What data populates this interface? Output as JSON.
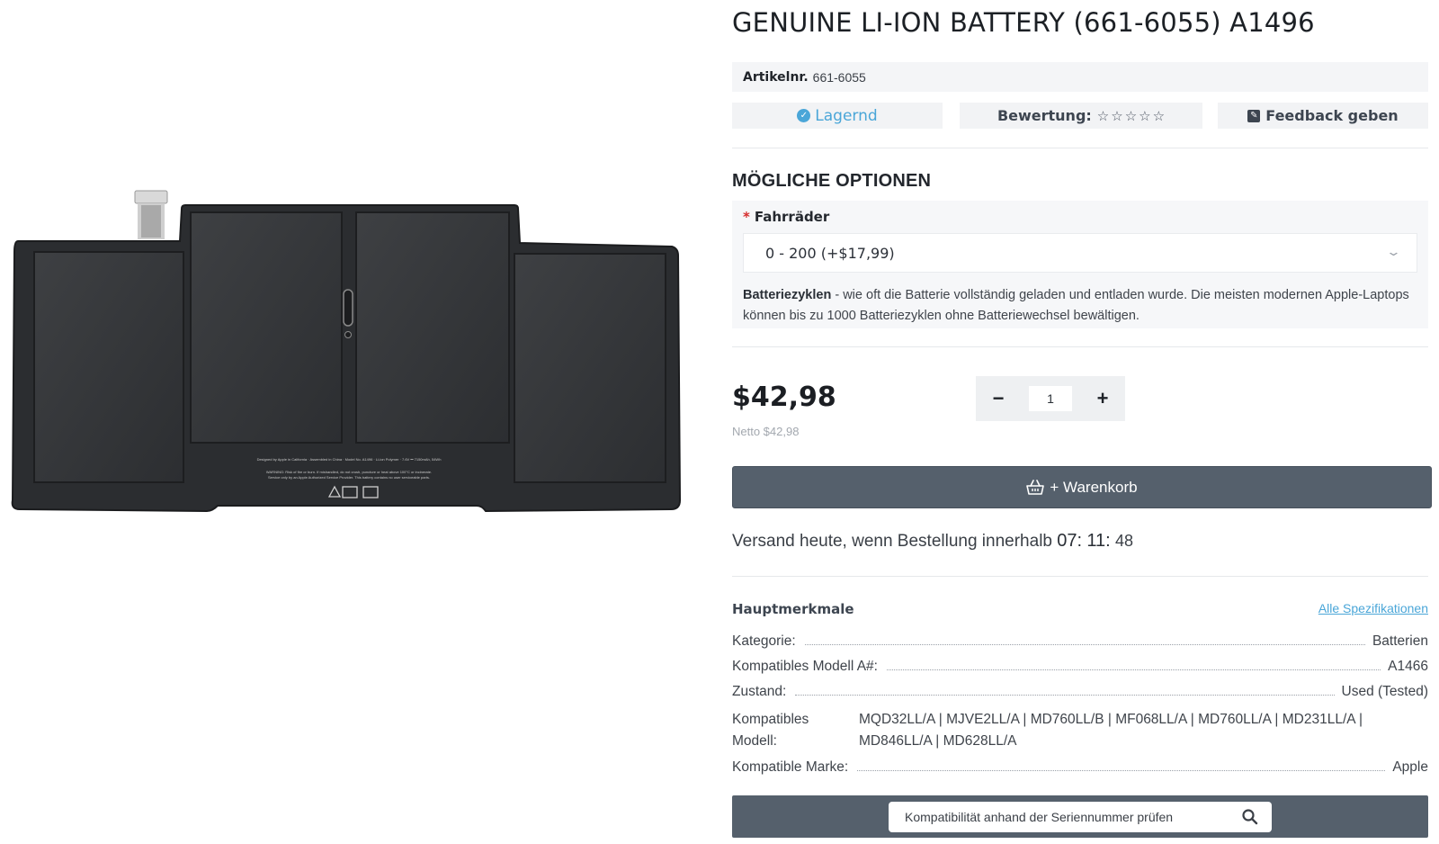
{
  "product": {
    "title": "GENUINE LI-ION BATTERY (661-6055) A1496",
    "sku_label": "Artikelnr.",
    "sku_value": "661-6055",
    "stock_label": "Lagernd",
    "rating_label": "Bewertung:",
    "rating_stars": 0,
    "feedback_label": "Feedback geben",
    "image_text": {
      "line1": "Designed by Apple in California · Assembled in China · Model No. A1496 · Li-ion Polymer · 7.6V ⎓ 7150mAh, 54Wh",
      "line2": "WARNING: Risk of fire or burn. If mishandled, do not crush, puncture or heat above 100°C or incinerate.",
      "line3": "Service only by an Apple Authorized Service Provider. This battery contains no user serviceable parts."
    }
  },
  "options": {
    "heading": "MÖGLICHE OPTIONEN",
    "field_label": "Fahrräder",
    "required_mark": "*",
    "selected_value": "0 - 200 (+$17,99)",
    "description_bold": "Batteriezyklen",
    "description_text": " - wie oft die Batterie vollständig geladen und entladen wurde. Die meisten modernen Apple-Laptops können bis zu 1000 Batteriezyklen ohne Batteriewechsel bewältigen."
  },
  "purchase": {
    "price": "$42,98",
    "netto": "Netto $42,98",
    "quantity": "1",
    "minus": "−",
    "plus": "+",
    "cart_label": "+ Warenkorb"
  },
  "shipping": {
    "prefix": "Versand heute, wenn Bestellung innerhalb",
    "hours": "07",
    "minutes": "11",
    "seconds": "48"
  },
  "specs": {
    "heading": "Hauptmerkmale",
    "all_link": "Alle Spezifikationen",
    "rows": [
      {
        "key": "Kategorie:",
        "value": "Batterien"
      },
      {
        "key": "Kompatibles Modell A#:",
        "value": "A1466"
      },
      {
        "key": "Zustand:",
        "value": "Used (Tested)"
      }
    ],
    "models_key": "Kompatibles Modell:",
    "models_value": "MQD32LL/A | MJVE2LL/A | MD760LL/B | MF068LL/A | MD760LL/A | MD231LL/A | MD846LL/A | MD628LL/A",
    "brand_key": "Kompatible Marke:",
    "brand_value": "Apple"
  },
  "serial_check": {
    "placeholder": "Kompatibilität anhand der Seriennummer prüfen"
  },
  "colors": {
    "accent": "#4aa6d8",
    "button_dark": "#55606c",
    "required": "#d62d2d"
  }
}
